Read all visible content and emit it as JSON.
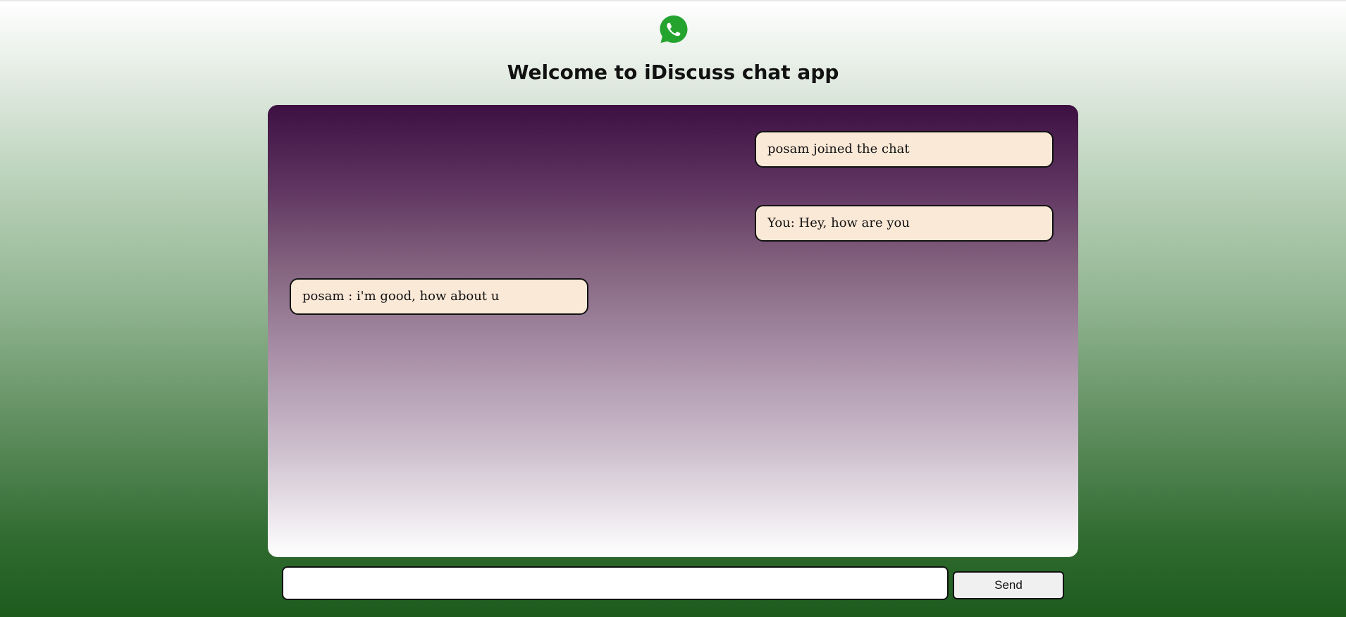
{
  "header": {
    "logo_icon": "whatsapp-icon",
    "title": "Welcome to iDiscuss chat app"
  },
  "chat": {
    "messages": [
      {
        "text": "posam joined the chat",
        "position": "right"
      },
      {
        "text": "You: Hey, how are you",
        "position": "right"
      },
      {
        "text": "posam : i'm good, how about u",
        "position": "left"
      }
    ]
  },
  "composer": {
    "input_value": "",
    "input_placeholder": "",
    "send_label": "Send"
  },
  "colors": {
    "bubble": "#fbe9d7",
    "logo_green": "#25a32f"
  }
}
